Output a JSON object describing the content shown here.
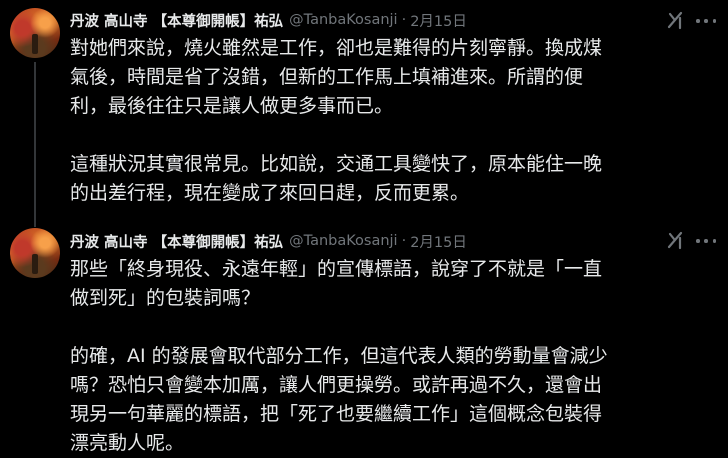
{
  "colors": {
    "background": "#000000",
    "text_primary": "#e7e9ea",
    "text_secondary": "#71767b",
    "thread_line": "#333639"
  },
  "tweets": [
    {
      "display_name": "丹波 高山寺 【本尊御開帳】祐弘",
      "handle": "@TanbaKosanji",
      "separator": "·",
      "time": "2月15日",
      "grok_icon": "grok-icon",
      "more_icon": "more-icon",
      "paragraphs": [
        "對她們來說，燒火雖然是工作，卻也是難得的片刻寧靜。換成煤\n氣後，時間是省了沒錯，但新的工作馬上填補進來。所謂的便\n利，最後往往只是讓人做更多事而已。",
        "這種狀況其實很常見。比如說，交通工具變快了，原本能住一晚\n的出差行程，現在變成了來回日趕，反而更累。"
      ]
    },
    {
      "display_name": "丹波 高山寺 【本尊御開帳】祐弘",
      "handle": "@TanbaKosanji",
      "separator": "·",
      "time": "2月15日",
      "grok_icon": "grok-icon",
      "more_icon": "more-icon",
      "paragraphs": [
        "那些「終身現役、永遠年輕」的宣傳標語，說穿了不就是「一直\n做到死」的包裝詞嗎？",
        "的確，AI 的發展會取代部分工作，但這代表人類的勞動量會減少\n嗎？恐怕只會變本加厲，讓人們更操勞。或許再過不久，還會出\n現另一句華麗的標語，把「死了也要繼續工作」這個概念包裝得\n漂亮動人呢。"
      ]
    }
  ]
}
